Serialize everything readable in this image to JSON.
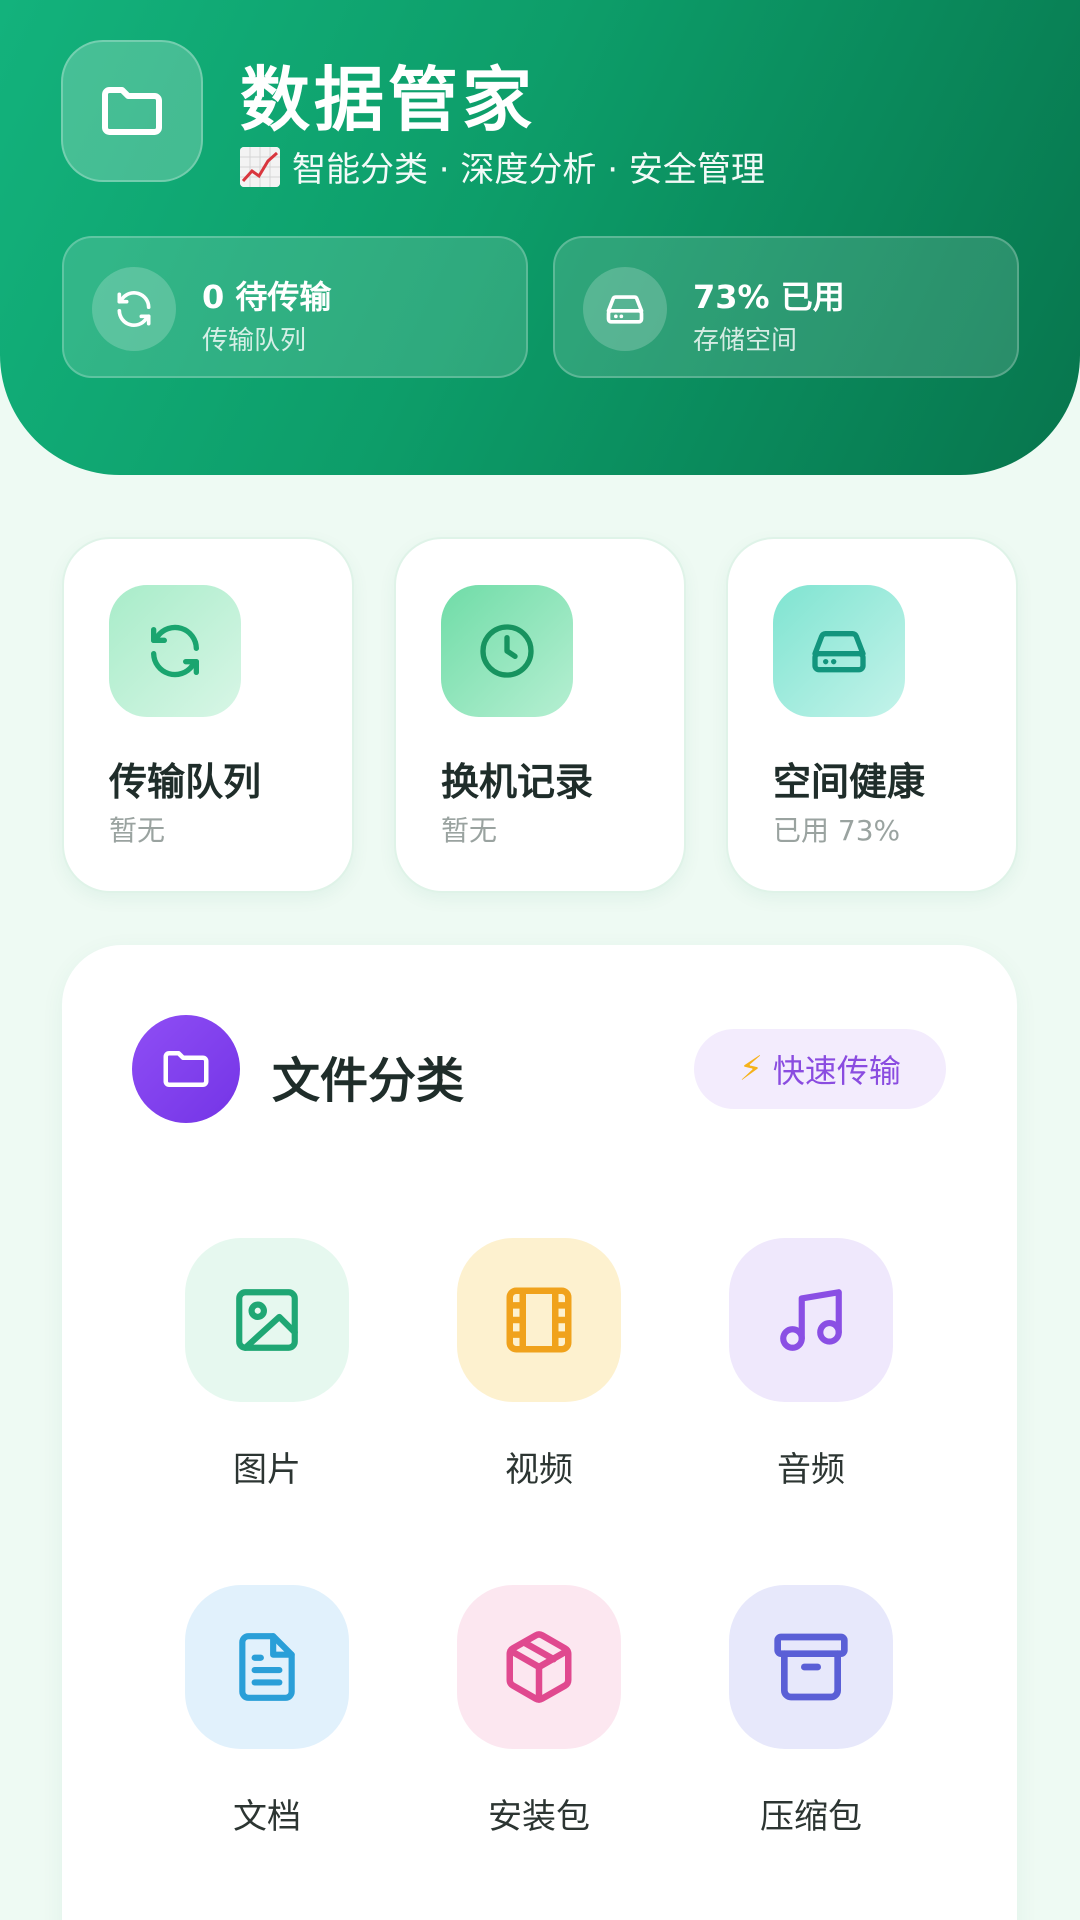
{
  "header": {
    "title": "数据管家",
    "subtitle": "智能分类 · 深度分析 · 安全管理",
    "stats": [
      {
        "value": "0 待传输",
        "label": "传输队列"
      },
      {
        "value": "73% 已用",
        "label": "存储空间"
      }
    ]
  },
  "quick_cards": [
    {
      "title": "传输队列",
      "sub": "暂无",
      "icon": "sync-icon",
      "color": "#1aa56f"
    },
    {
      "title": "换机记录",
      "sub": "暂无",
      "icon": "clock-icon",
      "color": "#1aa56f"
    },
    {
      "title": "空间健康",
      "sub": "已用 73%",
      "icon": "hard-drive-icon",
      "color": "#12a98b"
    }
  ],
  "file_panel": {
    "title": "文件分类",
    "quick_transfer_label": "快速传输",
    "categories": [
      {
        "label": "图片",
        "icon": "image-icon",
        "color": "#1fa774",
        "bg": "#e6f8ef"
      },
      {
        "label": "视频",
        "icon": "film-icon",
        "color": "#f0a21c",
        "bg": "#fdf1cf"
      },
      {
        "label": "音频",
        "icon": "music-icon",
        "color": "#8a4fe4",
        "bg": "#efe8fc"
      },
      {
        "label": "文档",
        "icon": "document-icon",
        "color": "#2a9fd8",
        "bg": "#e1f1fc"
      },
      {
        "label": "安装包",
        "icon": "package-icon",
        "color": "#e0498f",
        "bg": "#fce7f0"
      },
      {
        "label": "压缩包",
        "icon": "archive-box-icon",
        "color": "#5a5fd6",
        "bg": "#e7e8fb"
      }
    ]
  }
}
